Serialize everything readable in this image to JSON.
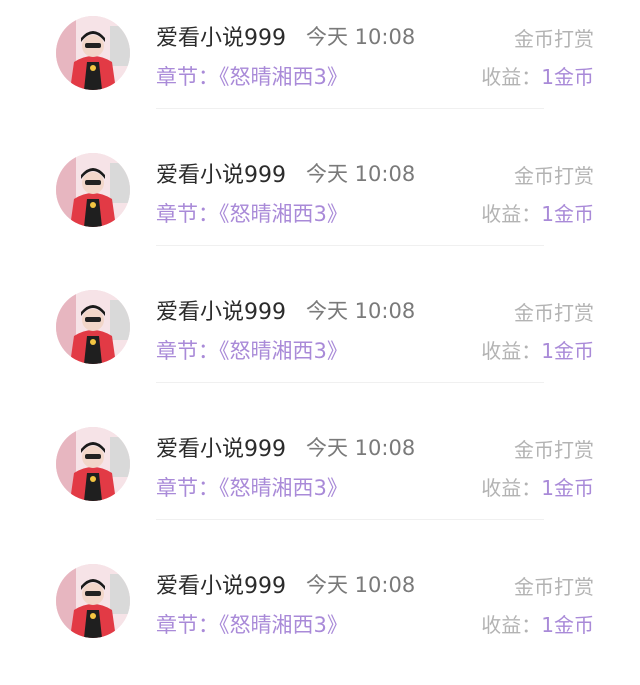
{
  "colors": {
    "accent": "#a98ad8",
    "muted": "#b3b3b3",
    "name": "#2b2b2b",
    "time": "#7a7a7a"
  },
  "records": [
    {
      "avatar_icon": "user-avatar",
      "nickname": "爱看小说999",
      "time": "今天 10:08",
      "type": "金币打赏",
      "chapter_label": "章节：",
      "chapter": "《怒晴湘西3》",
      "income_label": "收益：",
      "income_value": "1金币"
    },
    {
      "avatar_icon": "user-avatar",
      "nickname": "爱看小说999",
      "time": "今天 10:08",
      "type": "金币打赏",
      "chapter_label": "章节：",
      "chapter": "《怒晴湘西3》",
      "income_label": "收益：",
      "income_value": "1金币"
    },
    {
      "avatar_icon": "user-avatar",
      "nickname": "爱看小说999",
      "time": "今天 10:08",
      "type": "金币打赏",
      "chapter_label": "章节：",
      "chapter": "《怒晴湘西3》",
      "income_label": "收益：",
      "income_value": "1金币"
    },
    {
      "avatar_icon": "user-avatar",
      "nickname": "爱看小说999",
      "time": "今天 10:08",
      "type": "金币打赏",
      "chapter_label": "章节：",
      "chapter": "《怒晴湘西3》",
      "income_label": "收益：",
      "income_value": "1金币"
    },
    {
      "avatar_icon": "user-avatar",
      "nickname": "爱看小说999",
      "time": "今天 10:08",
      "type": "金币打赏",
      "chapter_label": "章节：",
      "chapter": "《怒晴湘西3》",
      "income_label": "收益：",
      "income_value": "1金币"
    }
  ]
}
